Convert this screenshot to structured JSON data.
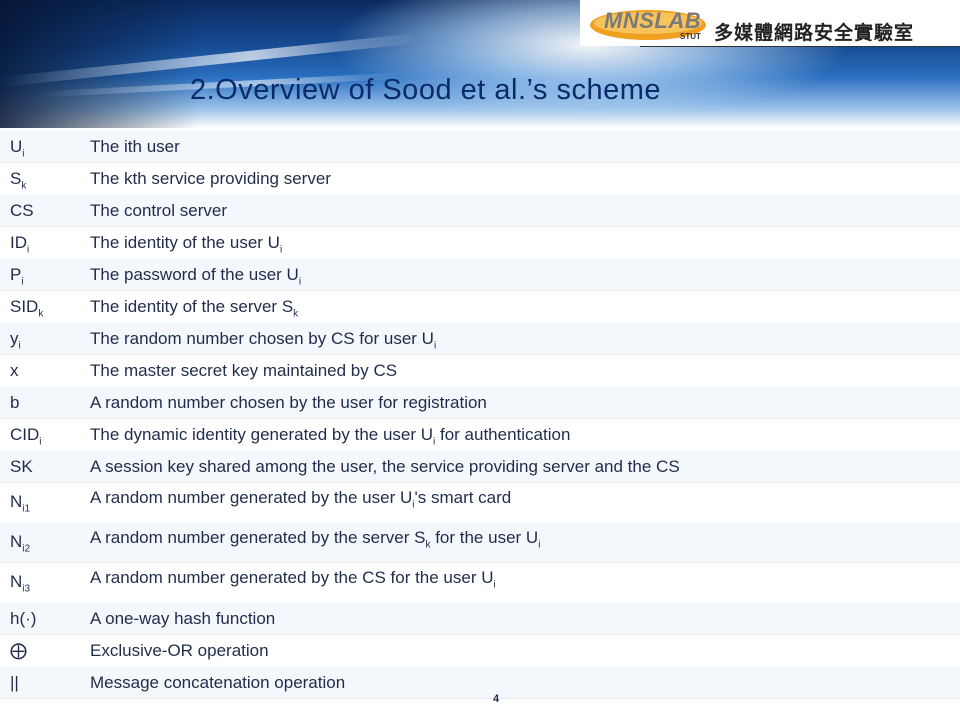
{
  "header": {
    "logo_text": "MNSLAB",
    "logo_sub": "STUT",
    "lab_name": "多媒體網路安全實驗室",
    "title": "2.Overview of Sood et al.’s scheme"
  },
  "table": {
    "rows": [
      {
        "sym": "U",
        "sym_sub": "i",
        "desc": "The ith user"
      },
      {
        "sym": "S",
        "sym_sub": "k",
        "desc": "The kth service providing server"
      },
      {
        "sym": "CS",
        "sym_sub": "",
        "desc": "The control server"
      },
      {
        "sym": "ID",
        "sym_sub": "i",
        "desc": "The identity of the user U",
        "desc_sub": "i"
      },
      {
        "sym": "P",
        "sym_sub": "i",
        "desc": "The password of the user U",
        "desc_sub": "i"
      },
      {
        "sym": "SID",
        "sym_sub": "k",
        "desc": "The identity of the server S",
        "desc_sub": "k"
      },
      {
        "sym": "y",
        "sym_sub": "i",
        "desc": "The random number chosen by CS for user U",
        "desc_sub": "i"
      },
      {
        "sym": "x",
        "sym_sub": "",
        "desc": "The master secret key maintained by CS"
      },
      {
        "sym": "b",
        "sym_sub": "",
        "desc": "A random number chosen by the user for registration"
      },
      {
        "sym": "CID",
        "sym_sub": "i",
        "desc": "The dynamic identity generated by the user U",
        "desc_sub": "i",
        "desc_tail": " for authentication"
      },
      {
        "sym": "SK",
        "sym_sub": "",
        "desc": "A session key shared among the user, the service providing server and the CS"
      },
      {
        "sym": "N",
        "sym_sub": "i1",
        "desc": "A random number generated by the user U",
        "desc_sub": "i",
        "desc_tail": "'s smart card"
      },
      {
        "sym": "N",
        "sym_sub": "i2",
        "desc": "A random number generated by the server S",
        "desc_sub": "k",
        "desc_tail": " for the user U",
        "desc_sub2": "i"
      },
      {
        "sym": "N",
        "sym_sub": "i3",
        "desc": "A random number generated by the CS for the user U",
        "desc_sub": "i"
      },
      {
        "sym": "h(·)",
        "sym_sub": "",
        "desc": "A one-way hash function"
      },
      {
        "sym": "⨁",
        "sym_sub": "",
        "desc": "Exclusive-OR operation"
      },
      {
        "sym": "||",
        "sym_sub": "",
        "desc": "Message concatenation operation"
      }
    ]
  },
  "footer": {
    "page_number": "4"
  }
}
